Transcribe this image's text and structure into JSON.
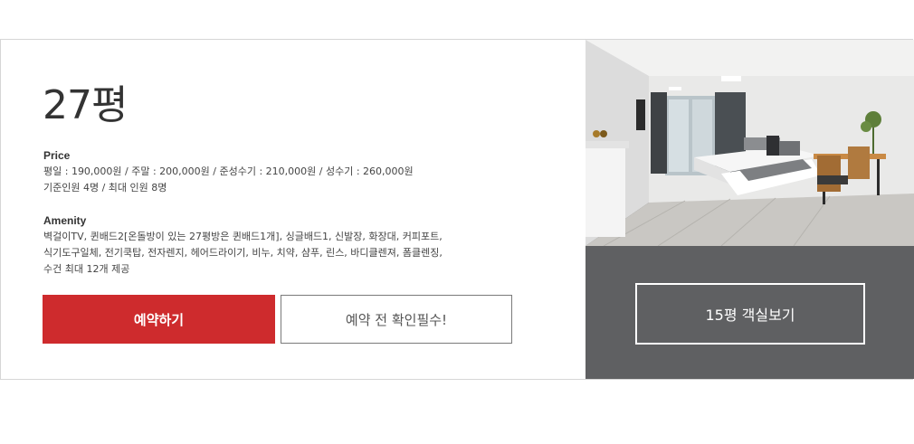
{
  "room": {
    "title": "27평",
    "price_label": "Price",
    "price_line1": "평일 : 190,000원 / 주말 : 200,000원 / 준성수기 : 210,000원 / 성수기 : 260,000원",
    "price_line2": "기준인원 4명 / 최대 인원 8명",
    "amenity_label": "Amenity",
    "amenity_line1": "벽걸이TV, 퀸배드2[온돌방이 있는 27평방은 퀸배드1개], 싱글배드1, 신발장, 화장대, 커피포트,",
    "amenity_line2": "식기도구일체, 전기쿡탑, 전자렌지, 헤어드라이기, 비누, 치약, 샴푸, 린스, 바디클렌져, 폼클렌징,",
    "amenity_line3": "수건 최대 12개 제공"
  },
  "buttons": {
    "reserve": "예약하기",
    "check_before": "예약 전 확인필수!",
    "view_other": "15평 객실보기"
  },
  "colors": {
    "primary": "#ce2b2d",
    "side_panel": "#5f6062"
  }
}
